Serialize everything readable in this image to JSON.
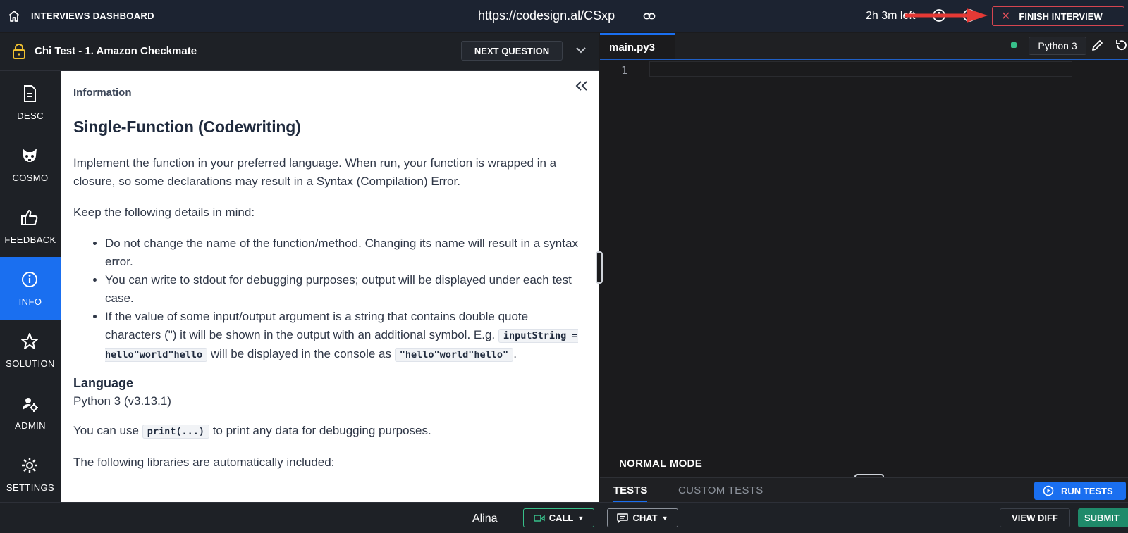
{
  "topbar": {
    "title": "INTERVIEWS DASHBOARD",
    "url": "https://codesign.al/CSxp",
    "time_left": "2h 3m left",
    "finish_label": "FINISH INTERVIEW",
    "annotation_arrow_color": "#e53935"
  },
  "question": {
    "title": "Chi Test - 1. Amazon Checkmate",
    "next_label": "NEXT QUESTION"
  },
  "sidebar": {
    "items": [
      {
        "label": "DESC",
        "icon": "document-icon"
      },
      {
        "label": "COSMO",
        "icon": "cosmo-icon"
      },
      {
        "label": "FEEDBACK",
        "icon": "thumbs-up-icon"
      },
      {
        "label": "INFO",
        "icon": "info-icon",
        "active": true
      },
      {
        "label": "SOLUTION",
        "icon": "star-icon"
      },
      {
        "label": "ADMIN",
        "icon": "admin-icon"
      },
      {
        "label": "SETTINGS",
        "icon": "gear-icon"
      }
    ]
  },
  "info": {
    "section": "Information",
    "heading": "Single-Function (Codewriting)",
    "intro": "Implement the function in your preferred language. When run, your function is wrapped in a closure, so some declarations may result in a Syntax (Compilation) Error.",
    "keep": "Keep the following details in mind:",
    "bullet1": "Do not change the name of the function/method. Changing its name will result in a syntax error.",
    "bullet2": "You can write to stdout for debugging purposes; output will be displayed under each test case.",
    "bullet3a": "If the value of some input/output argument is a string that contains double quote characters (\") it will be shown in the output with an additional symbol. E.g.",
    "code1": "inputString = hello\"world\"hello",
    "bullet3b": "will be displayed in the console as",
    "code2": "\"hello\"world\"hello\"",
    "bullet3c": ".",
    "language_heading": "Language",
    "language_value": "Python 3 (v3.13.1)",
    "print_a": "You can use",
    "print_code": "print(...)",
    "print_b": "to print any data for debugging purposes.",
    "libraries": "The following libraries are automatically included:"
  },
  "editor": {
    "tab": "main.py3",
    "language": "Python 3",
    "line_number": "1",
    "mode": "NORMAL MODE",
    "tests_tab": "TESTS",
    "custom_tab": "CUSTOM TESTS",
    "run_label": "RUN TESTS"
  },
  "bottombar": {
    "user": "Alina",
    "call_label": "CALL",
    "chat_label": "CHAT",
    "viewdiff_label": "VIEW DIFF",
    "submit_label": "SUBMIT"
  }
}
